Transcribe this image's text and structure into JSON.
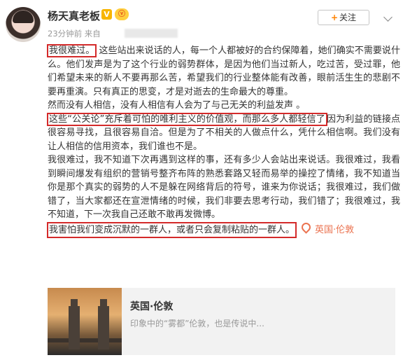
{
  "user": {
    "name": "杨天真老板",
    "verified_badge": "V",
    "vip_badge": "ⓥ",
    "time": "23分钟前",
    "source_label": "来自"
  },
  "follow_button": {
    "plus": "+",
    "label": "关注"
  },
  "post": {
    "p1_boxed": "我很难过。",
    "p1_rest": "这些站出来说话的人，每一个人都被好的合约保障着，她们确实不需要说什么。他们发声是为了这个行业的弱势群体，是因为他们当过新人，吃过苦，受过罪，他们希望未来的新人不要再那么苦，希望我们的行业整体能有改善，眼前活生生的悲剧不要再重演。只有真正的思变，才是对逝去的生命最大的尊重。",
    "p2": "然而没有人相信，没有人相信有人会为了与己无关的利益发声 。",
    "p3_boxed": "这些“公关论”充斥着可怕的唯利主义的价值观，而那么多人都轻信了",
    "p3_rest": "因为利益的链接点很容易寻找，且很容易自洽。但是为了不相关的人做点什么，凭什么相信啊。我们没有让人相信的信用资本，我们谁也不是。",
    "p4": "我很难过，我不知道下次再遇到这样的事，还有多少人会站出来说话。我很难过，我看到瞬间爆发有组织的营销号整齐布阵的熟悉套路又轻而易举的操控了情绪，我不知道当你是那个真实的弱势的人不是躲在网络背后的符号，谁来为你说话；我很难过，我们做错了，当大家都还在宣泄情绪的时候，我们非要去思考行动，我们错了；我很难过，我不知道，下一次我自己还敢不敢再发微博。",
    "p5_boxed": "我害怕我们变成沉默的一群人，或者只会复制粘贴的一群人。",
    "location": "英国·伦敦"
  },
  "card": {
    "title": "英国·伦敦",
    "description": "印象中的“雾都”伦敦，也是传说中..."
  }
}
